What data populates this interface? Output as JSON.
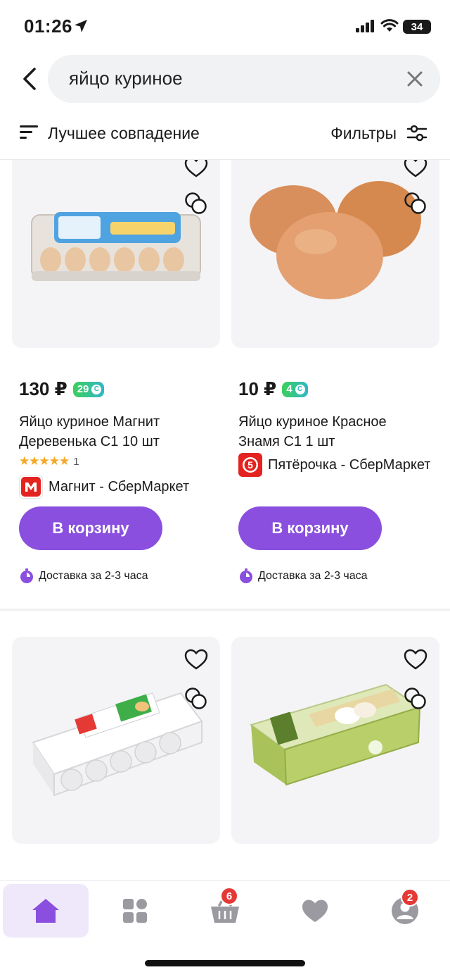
{
  "status_bar": {
    "time": "01:26",
    "battery": "34"
  },
  "search": {
    "query": "яйцо куриное"
  },
  "sort": {
    "label": "Лучшее совпадение"
  },
  "filters": {
    "label": "Фильтры"
  },
  "colors": {
    "accent": "#8a4fde",
    "bonus": "#3ccf5a",
    "badge": "#e53935",
    "rating": "#f5a623"
  },
  "products": [
    {
      "price": "130 ₽",
      "bonus": "29",
      "title_line1": "Яйцо куриное Магнит",
      "title_line2": "Деревенька С1 10 шт",
      "rating_count": "1",
      "rating_stars": 5,
      "store": "Магнит - СберМаркет",
      "store_icon": "magnit-logo-icon",
      "cart_label": "В корзину",
      "delivery": "Доставка за 2-3 часа"
    },
    {
      "price": "10 ₽",
      "bonus": "4",
      "title_line1": "Яйцо куриное Красное",
      "title_line2": "Знамя С1 1 шт",
      "store": "Пятёрочка - СберМаркет",
      "store_icon": "pyaterochka-logo-icon",
      "cart_label": "В корзину",
      "delivery": "Доставка за 2-3 часа"
    }
  ],
  "tabs": [
    {
      "name": "home",
      "icon": "home-icon"
    },
    {
      "name": "catalog",
      "icon": "catalog-icon"
    },
    {
      "name": "cart",
      "icon": "cart-icon",
      "badge": "6"
    },
    {
      "name": "favorites",
      "icon": "heart-icon"
    },
    {
      "name": "profile",
      "icon": "profile-icon",
      "badge": "2"
    }
  ]
}
